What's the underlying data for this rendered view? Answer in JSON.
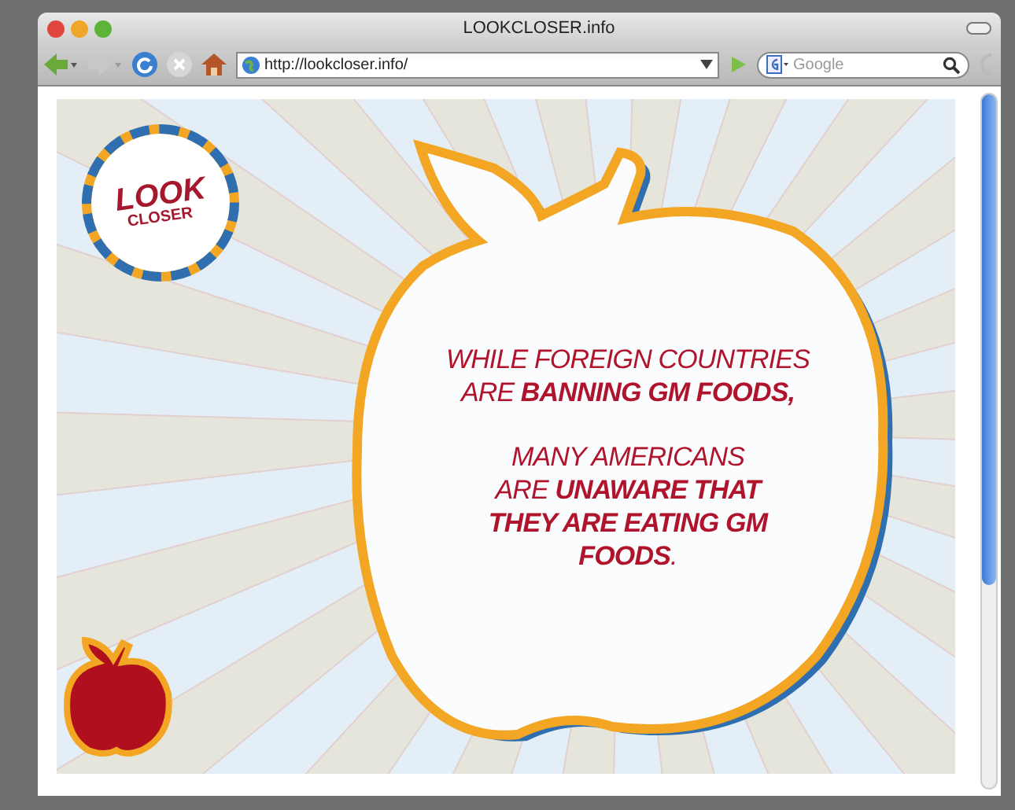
{
  "window": {
    "title": "LOOKCLOSER.info"
  },
  "address_bar": {
    "value": "http://lookcloser.info/"
  },
  "search": {
    "placeholder": "Google"
  },
  "logo": {
    "line_1": "LOOK",
    "line_2": "CLOSER"
  },
  "message": {
    "paragraphs": [
      "WHILE FOREIGN COUNTRIES\nARE **BANNING GM FOODS,**",
      "MANY AMERICANS\nARE **UNAWARE THAT**\n**THEY ARE EATING GM**\n**FOODS**."
    ]
  }
}
